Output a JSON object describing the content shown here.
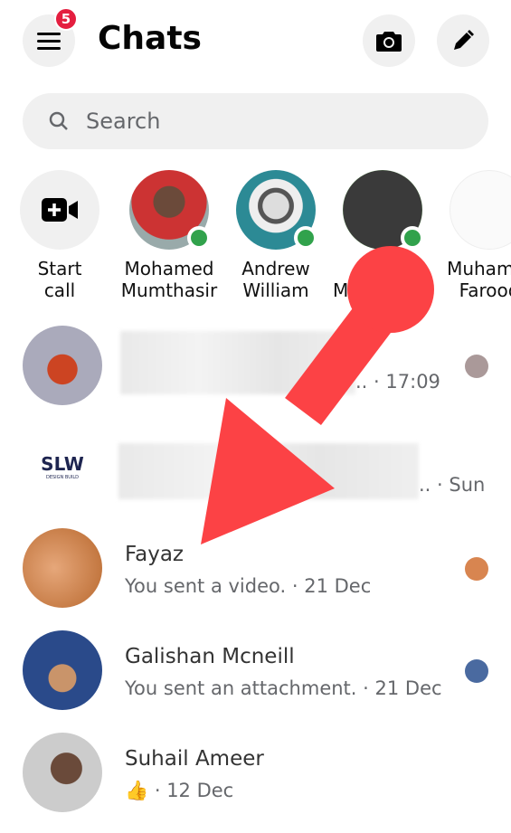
{
  "header": {
    "title": "Chats",
    "notification_count": "5"
  },
  "search": {
    "placeholder": "Search"
  },
  "stories": [
    {
      "name": "Start\ncall"
    },
    {
      "name": "Mohamed\nMumthasir"
    },
    {
      "name": "Andrew\nWilliam"
    },
    {
      "name": "M"
    },
    {
      "name": "Muhamm\nFarooq"
    }
  ],
  "chats": [
    {
      "name": "",
      "preview": "..",
      "time": "· 17:09"
    },
    {
      "name": "",
      "preview": "..",
      "time": "· Sun",
      "logo": "SLW",
      "logo_sub": "DESIGN BUILD"
    },
    {
      "name": "Fayaz",
      "preview": "You sent a video.",
      "time": "· 21 Dec"
    },
    {
      "name": "Galishan Mcneill",
      "preview": "You sent an attachment.",
      "time": "· 21 Dec"
    },
    {
      "name": "Suhail Ameer",
      "preview": "👍",
      "time": "· 12 Dec"
    }
  ],
  "colors": {
    "online": "#31a24c",
    "badge": "#e41e3f",
    "annotation_arrow": "#fc4245"
  }
}
